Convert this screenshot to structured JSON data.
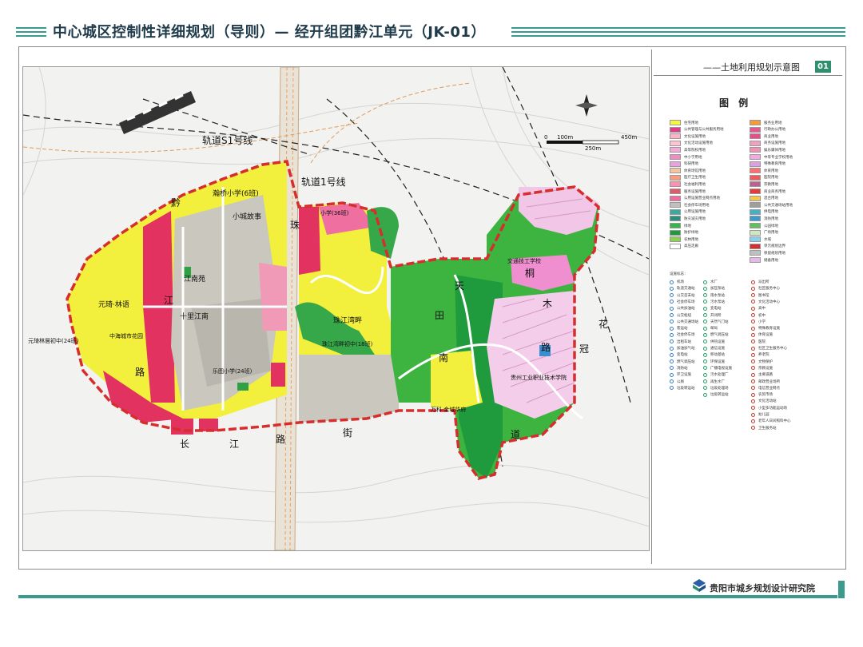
{
  "header": {
    "title": "中心城区控制性详细规划（导则）— 经开组团黔江单元（JK-01）"
  },
  "map_panel": {
    "subtitle": "——土地利用规划示意图",
    "number": "01",
    "legend_title": "图 例",
    "facility_head": "设施标志：",
    "scale": {
      "zero": "0",
      "mid": "100m",
      "end": "450m",
      "bar2": "250m"
    }
  },
  "map_labels": {
    "rail_s1": "轨道S1号线",
    "rail_1": "轨道1号线",
    "xiaocheng": "小城故事",
    "hanfeng": "瀚桥小学(6班)",
    "jiangnan_yuan": "江南苑",
    "shili_jiangnan": "十里江南",
    "yuanqi_linyu": "元琦·林语",
    "zhonghai": "中海城市花园",
    "yuanqi_school": "元琦林居初中(24班)",
    "lezhu_school": "乐图小学(24班)",
    "zhujiang_wan": "珠江湾畔",
    "zhujiang_school": "珠江湾畔初中(18班)",
    "top_school": "小学(36班)",
    "jiaotong_school": "交通技工学校",
    "guimao_school": "贵州工业职业技术学院",
    "wanke": "万科·金域华府",
    "road_qian": "黔",
    "road_jiang": "江",
    "road_lu": "路",
    "road_zhu": "珠",
    "road_tian": "天",
    "road_tian2": "田",
    "road_nan": "南",
    "road_tong": "桐",
    "road_mu": "木",
    "road_lu2": "路",
    "road_hua": "花",
    "road_guan": "冠",
    "road_chang": "长",
    "road_jiang2": "江",
    "road_lu3": "路",
    "road_jie": "街",
    "road_dao": "道"
  },
  "legend": {
    "left": [
      {
        "label": "住宅用地",
        "color": "#f5f542"
      },
      {
        "label": "公共管理与公共服务用地",
        "color": "#e63b86"
      },
      {
        "label": "文化设施用地",
        "color": "#ffb3c6"
      },
      {
        "label": "文化活动设施用地",
        "color": "#ffc4d4"
      },
      {
        "label": "高等院校用地",
        "color": "#f7a8d8"
      },
      {
        "label": "中小学用地",
        "color": "#f08cc4"
      },
      {
        "label": "科研用地",
        "color": "#e8a2e0"
      },
      {
        "label": "体育场馆用地",
        "color": "#f5c4a0"
      },
      {
        "label": "医疗卫生用地",
        "color": "#ff9a7a"
      },
      {
        "label": "社会福利用地",
        "color": "#ff8fb0"
      },
      {
        "label": "服务设施用地",
        "color": "#e05a6a"
      },
      {
        "label": "公用设施营业网点用地",
        "color": "#ef6b9b"
      },
      {
        "label": "社会停车场用地",
        "color": "#bfbfbf"
      },
      {
        "label": "公用设施用地",
        "color": "#3aa9a0"
      },
      {
        "label": "防灾减灾用地",
        "color": "#2a8f80"
      },
      {
        "label": "绿地",
        "color": "#38b54a"
      },
      {
        "label": "防护绿地",
        "color": "#1f9a3c"
      },
      {
        "label": "农林用地",
        "color": "#8fd14f"
      },
      {
        "label": "高压走廊",
        "color": "#ffffff"
      }
    ],
    "right": [
      {
        "label": "服务业用地",
        "color": "#f79b3a"
      },
      {
        "label": "行政办公用地",
        "color": "#e8568e"
      },
      {
        "label": "商业用地",
        "color": "#e84d8a"
      },
      {
        "label": "商务设施用地",
        "color": "#f0a0c0"
      },
      {
        "label": "娱乐康体用地",
        "color": "#f48fb1"
      },
      {
        "label": "中等专业学校用地",
        "color": "#f5a9e0"
      },
      {
        "label": "特殊教育用地",
        "color": "#d9a0e8"
      },
      {
        "label": "体育用地",
        "color": "#ff6f6f"
      },
      {
        "label": "医院用地",
        "color": "#f55a5a"
      },
      {
        "label": "宗教用地",
        "color": "#c06090"
      },
      {
        "label": "商业商务用地",
        "color": "#e63b3b"
      },
      {
        "label": "混合用地",
        "color": "#f2c94c"
      },
      {
        "label": "公共交通场站用地",
        "color": "#9e9e9e"
      },
      {
        "label": "供电用地",
        "color": "#46b0c6"
      },
      {
        "label": "消防用地",
        "color": "#3c9ad2"
      },
      {
        "label": "公园绿地",
        "color": "#60c060"
      },
      {
        "label": "广场用地",
        "color": "#d0e8c0"
      },
      {
        "label": "水域",
        "color": "#8ad0f0"
      },
      {
        "label": "单元规划边界",
        "color": "#d62d2d"
      },
      {
        "label": "保留规划用地",
        "color": "#c0c0c0"
      },
      {
        "label": "储备用地",
        "color": "#e5b8e8"
      }
    ]
  },
  "facilities": {
    "col1": [
      "机场",
      "轨道交通站",
      "公交首末站",
      "社会停车场",
      "公共加油站",
      "公交枢纽",
      "公共交通场站",
      "客运站",
      "社会停车场",
      "出租车站",
      "加油加气站",
      "变电站",
      "燃气调压站",
      "消防站",
      "环卫设施",
      "公厕",
      "垃圾转运站"
    ],
    "col2": [
      "水厂",
      "加压泵站",
      "雨水泵站",
      "污水泵站",
      "变电站",
      "开闭所",
      "天然气门站",
      "邮局",
      "燃气调压站",
      "供热设施",
      "通信设施",
      "移动基站",
      "环保设施",
      "广播电视设施",
      "污水处理厂",
      "再生水厂",
      "垃圾处理场",
      "垃圾转运站"
    ],
    "col3": [
      "派出所",
      "社区服务中心",
      "图书馆",
      "文化活动中心",
      "高中",
      "初中",
      "小学",
      "特殊教育设施",
      "体育设施",
      "医院",
      "社区卫生服务中心",
      "养老院",
      "文物保护",
      "宗教设施",
      "主要道路",
      "邮政营业场所",
      "电信营业网点",
      "农贸市场",
      "文化活动站",
      "小型多功能运动场",
      "幼儿园",
      "老年人日间照料中心",
      "卫生服务站"
    ]
  },
  "footer": {
    "org": "贵阳市城乡规划设计研究院"
  }
}
